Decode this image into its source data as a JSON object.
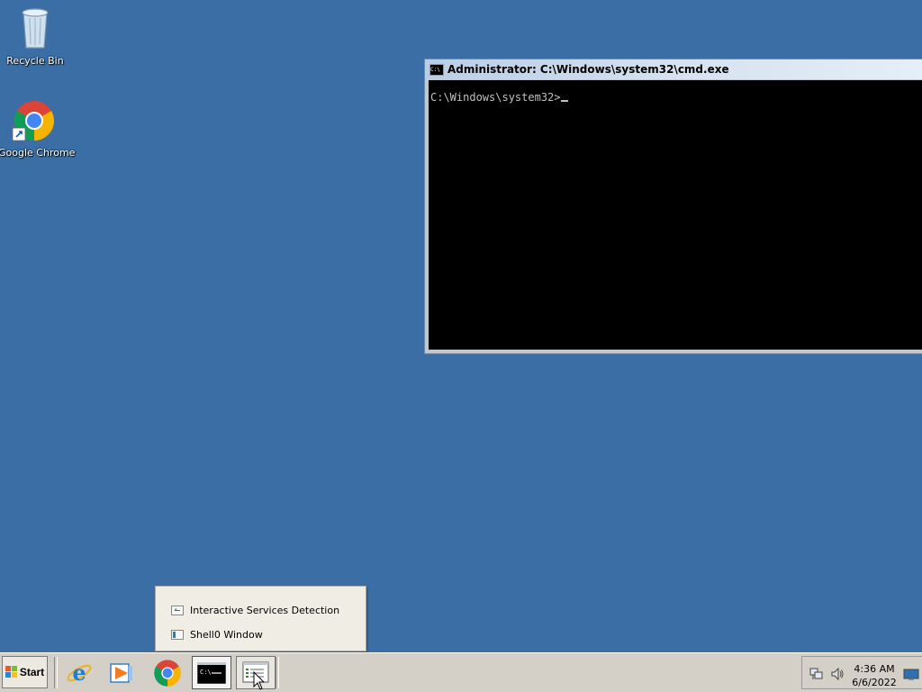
{
  "desktop": {
    "icons": [
      {
        "label": "Recycle Bin"
      },
      {
        "label": "Google Chrome"
      }
    ]
  },
  "cmd_window": {
    "title": "Administrator: C:\\Windows\\system32\\cmd.exe",
    "prompt": "C:\\Windows\\system32>"
  },
  "popup": {
    "items": [
      {
        "label": "Interactive Services Detection"
      },
      {
        "label": "Shell0 Window"
      }
    ]
  },
  "taskbar": {
    "start_label": "Start",
    "clock": {
      "time": "4:36 AM",
      "date": "6/6/2022"
    }
  },
  "colors": {
    "desktop_background": "#3a6ea5",
    "console_background": "#000000",
    "taskbar_background": "#d4d0c8"
  }
}
